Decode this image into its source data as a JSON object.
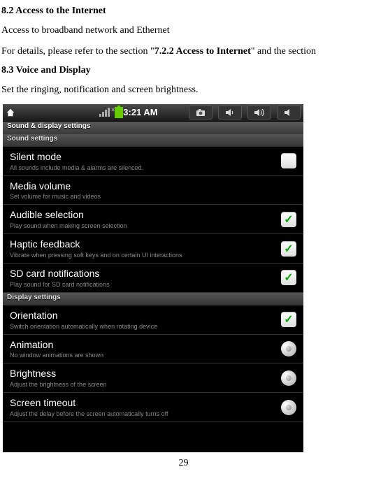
{
  "doc": {
    "section82_heading": "8.2 Access to the Internet",
    "section82_text": "Access to broadband network and Ethernet",
    "details_prefix": "For details, please refer to the section \"",
    "details_bold": "7.2.2 Access to Internet",
    "details_suffix": "\" and the section",
    "section83_heading": "8.3 Voice and Display",
    "section83_text": "Set the ringing, notification and screen brightness.",
    "page_number": "29"
  },
  "statusbar": {
    "time": "3:21 AM"
  },
  "breadcrumb": "Sound & display settings",
  "subheader_sound": "Sound settings",
  "subheader_display": "Display settings",
  "items": {
    "silent": {
      "title": "Silent mode",
      "subtitle": "All sounds include media & alarms are silenced."
    },
    "media": {
      "title": "Media volume",
      "subtitle": "Set volume for music and videos"
    },
    "audible": {
      "title": "Audible selection",
      "subtitle": "Play sound when making screen selection"
    },
    "haptic": {
      "title": "Haptic feedback",
      "subtitle": "Vibrate when pressing soft keys and on certain UI interactions"
    },
    "sdcard": {
      "title": "SD card notifications",
      "subtitle": "Play sound for SD card notifications"
    },
    "orientation": {
      "title": "Orientation",
      "subtitle": "Switch orientation automatically when rotating device"
    },
    "animation": {
      "title": "Animation",
      "subtitle": "No window animations are shown"
    },
    "brightness": {
      "title": "Brightness",
      "subtitle": "Adjust the brightness of the screen"
    },
    "timeout": {
      "title": "Screen timeout",
      "subtitle": "Adjust the delay before the screen automatically turns off"
    }
  }
}
